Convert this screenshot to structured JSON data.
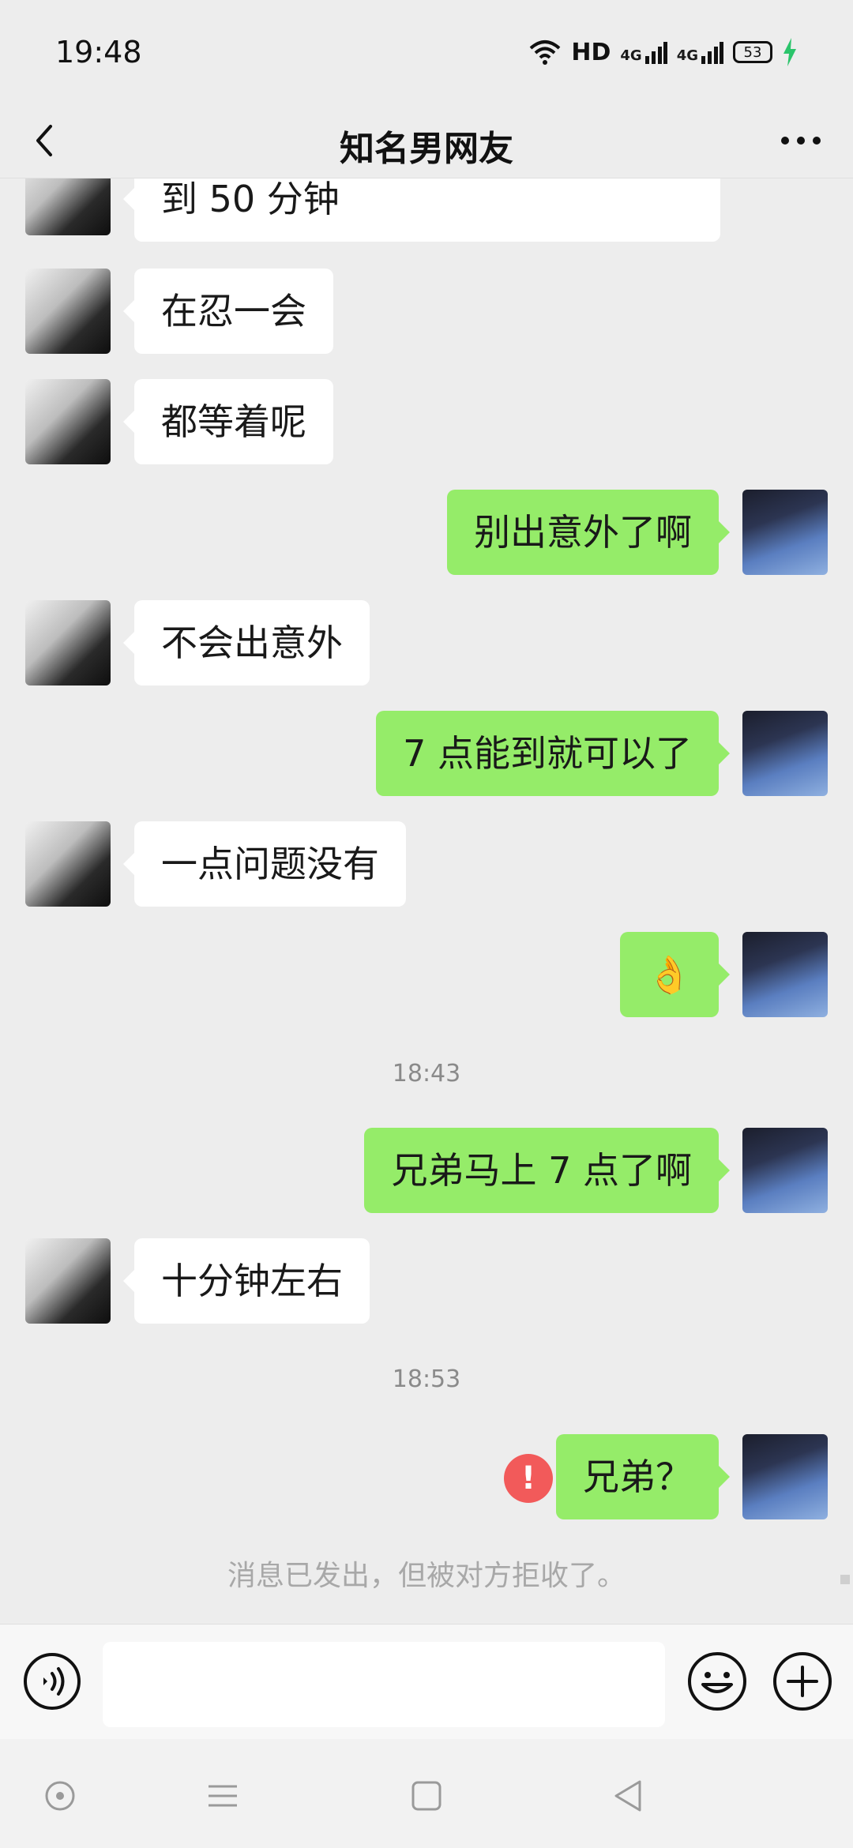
{
  "status_bar": {
    "time": "19:48",
    "network_label": "HD",
    "signal_labels": [
      "4G",
      "4G"
    ],
    "battery_level": "53",
    "icons": [
      "wifi-icon",
      "signal-icon",
      "signal-icon",
      "battery-icon",
      "charging-icon"
    ]
  },
  "header": {
    "title": "知名男网友",
    "back_icon": "chevron-left-icon",
    "more_icon": "more-dots-icon"
  },
  "messages": [
    {
      "from": "them",
      "text": "到 50 分钟"
    },
    {
      "from": "them",
      "text": "在忍一会"
    },
    {
      "from": "them",
      "text": "都等着呢"
    },
    {
      "from": "me",
      "text": "别出意外了啊"
    },
    {
      "from": "them",
      "text": "不会出意外"
    },
    {
      "from": "me",
      "text": "7 点能到就可以了"
    },
    {
      "from": "them",
      "text": "一点问题没有"
    },
    {
      "from": "me",
      "text": "👌"
    },
    {
      "from": "me",
      "text": "兄弟马上 7 点了啊"
    },
    {
      "from": "them",
      "text": "十分钟左右"
    },
    {
      "from": "me",
      "text": "兄弟？"
    }
  ],
  "timestamps": [
    "18:43",
    "18:53"
  ],
  "send_error_mark": "!",
  "rejected_note": "消息已发出，但被对方拒收了。",
  "input_bar": {
    "placeholder": "",
    "icons": [
      "voice-icon",
      "emoji-icon",
      "plus-icon"
    ]
  },
  "nav_bar": {
    "icons": [
      "assistant-icon",
      "menu-icon",
      "home-icon",
      "back-icon"
    ]
  },
  "colors": {
    "background": "#ededed",
    "my_bubble": "#95ec69",
    "their_bubble": "#ffffff",
    "error": "#f25a5a"
  }
}
